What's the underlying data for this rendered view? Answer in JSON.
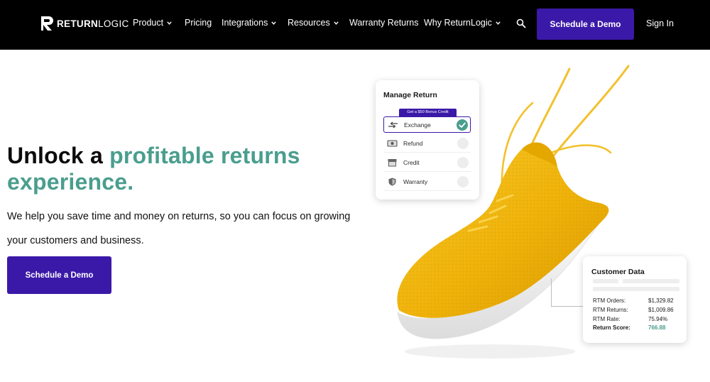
{
  "nav": {
    "logo_bold": "RETURN",
    "logo_light": "LOGIC",
    "items": [
      {
        "label": "Product",
        "dropdown": true
      },
      {
        "label": "Pricing",
        "dropdown": false
      },
      {
        "label": "Integrations",
        "dropdown": true
      },
      {
        "label": "Resources",
        "dropdown": true
      },
      {
        "label": "Warranty Returns",
        "dropdown": false
      },
      {
        "label": "Why ReturnLogic",
        "dropdown": true
      }
    ],
    "search_icon": "search-icon",
    "cta_label": "Schedule a Demo",
    "signin_label": "Sign In"
  },
  "hero": {
    "headline_part1": "Unlock a ",
    "headline_accent": "profitable returns experience.",
    "subtext": "We help you save time and money on returns, so you can focus on growing your customers and business.",
    "cta_label": "Schedule a Demo"
  },
  "manage_return": {
    "title": "Manage Return",
    "bonus_badge": "Get a $50 Bonus Credit",
    "options": [
      {
        "label": "Exchange",
        "icon": "exchange-arrows-icon",
        "selected": true
      },
      {
        "label": "Refund",
        "icon": "cash-icon",
        "selected": false
      },
      {
        "label": "Credit",
        "icon": "store-icon",
        "selected": false
      },
      {
        "label": "Warranty",
        "icon": "shield-icon",
        "selected": false
      }
    ]
  },
  "customer_data": {
    "title": "Customer Data",
    "rows": [
      {
        "key": "RTM Orders:",
        "value": "$1,329.82"
      },
      {
        "key": "RTM Returns:",
        "value": "$1,009.86"
      },
      {
        "key": "RTM Rate:",
        "value": "75.94%"
      },
      {
        "key": "Return Score:",
        "value": "766.88"
      }
    ]
  },
  "colors": {
    "brand_purple": "#3b19a8",
    "accent_teal": "#4a9e8e",
    "nav_bg": "#000000",
    "shoe_yellow": "#f2b705"
  }
}
